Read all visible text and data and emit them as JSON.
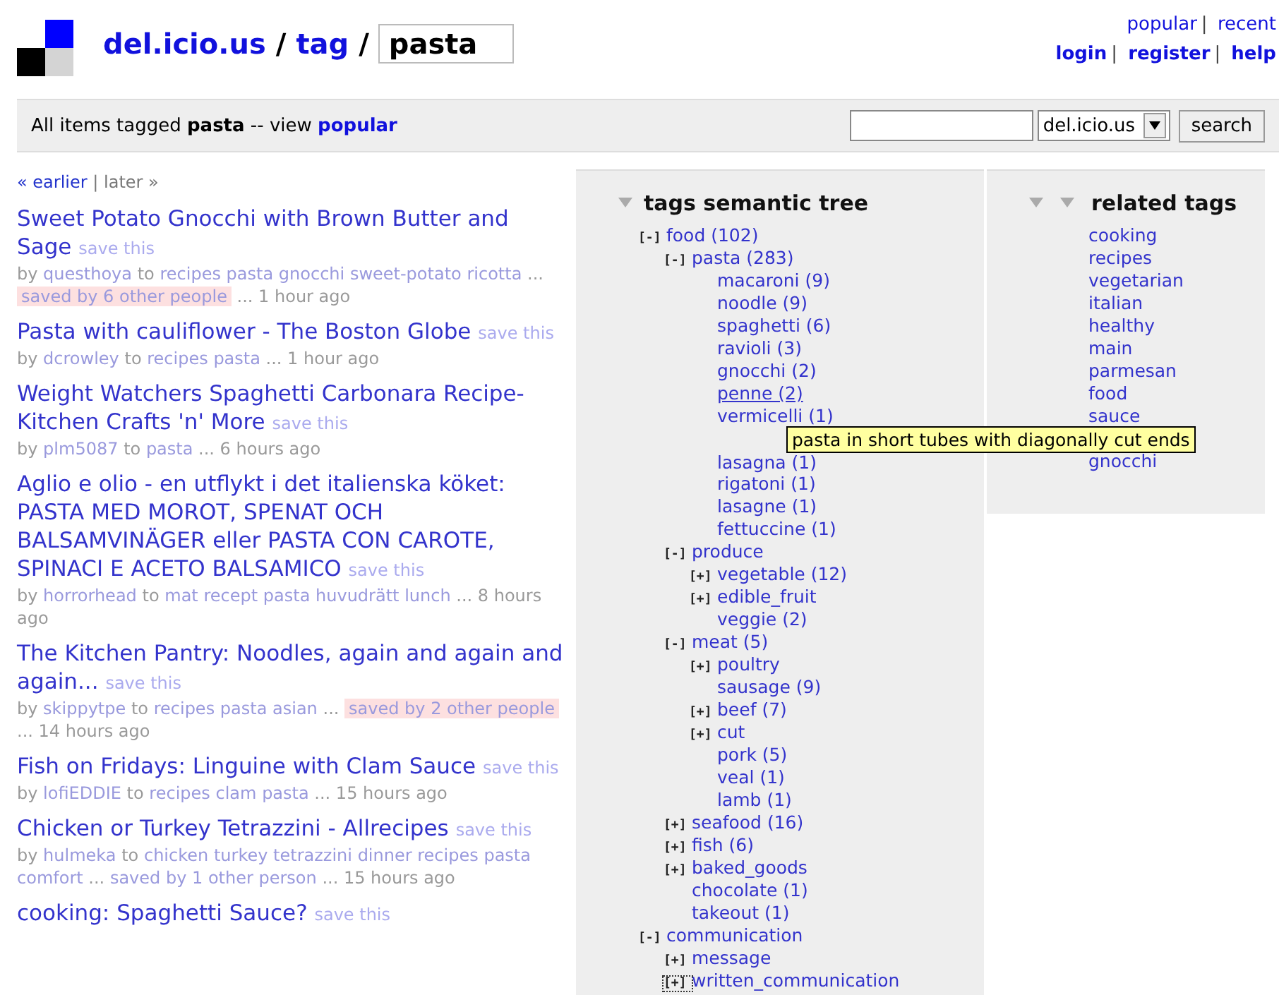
{
  "header": {
    "site": "del.icio.us",
    "sep1": "/",
    "section": "tag",
    "sep2": "/",
    "tag_value": "pasta",
    "top_links": [
      "popular",
      "recent"
    ],
    "top_sep": "|",
    "user_links": [
      "login",
      "register",
      "help"
    ],
    "user_sep": "|"
  },
  "bar": {
    "prefix": "All items tagged",
    "tag": "pasta",
    "middle": "-- view",
    "link": "popular",
    "scope": "del.icio.us",
    "button": "search"
  },
  "pager": {
    "earlier": "« earlier",
    "sep": "|",
    "later": "later »"
  },
  "posts": [
    {
      "title": "Sweet Potato Gnocchi with Brown Butter and Sage",
      "save": "save this",
      "meta": [
        {
          "kind": "plain",
          "text": "by"
        },
        {
          "kind": "link",
          "text": "questhoya"
        },
        {
          "kind": "plain",
          "text": "to"
        },
        {
          "kind": "link",
          "text": "recipes"
        },
        {
          "kind": "link",
          "text": "pasta"
        },
        {
          "kind": "link",
          "text": "gnocchi"
        },
        {
          "kind": "link",
          "text": "sweet-potato"
        },
        {
          "kind": "link",
          "text": "ricotta"
        },
        {
          "kind": "plain",
          "text": "..."
        },
        {
          "kind": "saved",
          "text": "saved by 6 other people"
        },
        {
          "kind": "plain",
          "text": "... 1 hour ago"
        }
      ]
    },
    {
      "title": "Pasta with cauliflower - The Boston Globe",
      "save": "save this",
      "meta": [
        {
          "kind": "plain",
          "text": "by"
        },
        {
          "kind": "link",
          "text": "dcrowley"
        },
        {
          "kind": "plain",
          "text": "to"
        },
        {
          "kind": "link",
          "text": "recipes"
        },
        {
          "kind": "link",
          "text": "pasta"
        },
        {
          "kind": "plain",
          "text": "... 1 hour ago"
        }
      ]
    },
    {
      "title": "Weight Watchers Spaghetti Carbonara Recipe- Kitchen Crafts 'n' More",
      "save": "save this",
      "meta": [
        {
          "kind": "plain",
          "text": "by"
        },
        {
          "kind": "link",
          "text": "plm5087"
        },
        {
          "kind": "plain",
          "text": "to"
        },
        {
          "kind": "link",
          "text": "pasta"
        },
        {
          "kind": "plain",
          "text": "... 6 hours ago"
        }
      ]
    },
    {
      "title": "Aglio e olio - en utflykt i det italienska köket: PASTA MED MOROT, SPENAT OCH BALSAMVINÄGER eller PASTA CON CAROTE, SPINACI E ACETO BALSAMICO",
      "save": "save this",
      "meta": [
        {
          "kind": "plain",
          "text": "by"
        },
        {
          "kind": "link",
          "text": "horrorhead"
        },
        {
          "kind": "plain",
          "text": "to"
        },
        {
          "kind": "link",
          "text": "mat"
        },
        {
          "kind": "link",
          "text": "recept"
        },
        {
          "kind": "link",
          "text": "pasta"
        },
        {
          "kind": "link",
          "text": "huvudrätt"
        },
        {
          "kind": "link",
          "text": "lunch"
        },
        {
          "kind": "plain",
          "text": "... 8 hours ago"
        }
      ]
    },
    {
      "title": "The Kitchen Pantry: Noodles, again and again and again...",
      "save": "save this",
      "meta": [
        {
          "kind": "plain",
          "text": "by"
        },
        {
          "kind": "link",
          "text": "skippytpe"
        },
        {
          "kind": "plain",
          "text": "to"
        },
        {
          "kind": "link",
          "text": "recipes"
        },
        {
          "kind": "link",
          "text": "pasta"
        },
        {
          "kind": "link",
          "text": "asian"
        },
        {
          "kind": "plain",
          "text": "..."
        },
        {
          "kind": "saved",
          "text": "saved by 2 other people"
        },
        {
          "kind": "plain",
          "text": "... 14 hours ago"
        }
      ]
    },
    {
      "title": "Fish on Fridays: Linguine with Clam Sauce",
      "save": "save this",
      "meta": [
        {
          "kind": "plain",
          "text": "by"
        },
        {
          "kind": "link",
          "text": "lofiEDDIE"
        },
        {
          "kind": "plain",
          "text": "to"
        },
        {
          "kind": "link",
          "text": "recipes"
        },
        {
          "kind": "link",
          "text": "clam"
        },
        {
          "kind": "link",
          "text": "pasta"
        },
        {
          "kind": "plain",
          "text": "... 15 hours ago"
        }
      ]
    },
    {
      "title": "Chicken or Turkey Tetrazzini - Allrecipes",
      "save": "save this",
      "meta": [
        {
          "kind": "plain",
          "text": "by"
        },
        {
          "kind": "link",
          "text": "hulmeka"
        },
        {
          "kind": "plain",
          "text": "to"
        },
        {
          "kind": "link",
          "text": "chicken"
        },
        {
          "kind": "link",
          "text": "turkey"
        },
        {
          "kind": "link",
          "text": "tetrazzini"
        },
        {
          "kind": "link",
          "text": "dinner"
        },
        {
          "kind": "link",
          "text": "recipes"
        },
        {
          "kind": "link",
          "text": "pasta"
        },
        {
          "kind": "link",
          "text": "comfort"
        },
        {
          "kind": "plain",
          "text": "..."
        },
        {
          "kind": "link",
          "text": "saved by 1 other person"
        },
        {
          "kind": "plain",
          "text": "... 15 hours ago"
        }
      ]
    },
    {
      "title": "cooking: Spaghetti Sauce?",
      "save": "save this"
    }
  ],
  "tree": {
    "title": "tags semantic tree",
    "nodes": [
      {
        "toggle": "[-]",
        "label": "food (102)",
        "children": [
          {
            "toggle": "[-]",
            "label": "pasta (283)",
            "children": [
              {
                "label": "macaroni (9)"
              },
              {
                "label": "noodle (9)"
              },
              {
                "label": "spaghetti (6)"
              },
              {
                "label": "ravioli (3)"
              },
              {
                "label": "gnocchi (2)"
              },
              {
                "label": "penne (2)",
                "hovered": true
              },
              {
                "label": "vermicelli (1)"
              },
              {
                "label": "lasagna (1)",
                "hidden_above": true
              },
              {
                "label": "rigatoni (1)"
              },
              {
                "label": "lasagne (1)"
              },
              {
                "label": "fettuccine (1)"
              }
            ]
          },
          {
            "toggle": "[-]",
            "label": "produce",
            "children": [
              {
                "toggle": "[+]",
                "label": "vegetable (12)"
              },
              {
                "toggle": "[+]",
                "label": "edible_fruit"
              },
              {
                "label": "veggie (2)"
              }
            ]
          },
          {
            "toggle": "[-]",
            "label": "meat (5)",
            "children": [
              {
                "toggle": "[+]",
                "label": "poultry"
              },
              {
                "label": "sausage (9)"
              },
              {
                "toggle": "[+]",
                "label": "beef (7)"
              },
              {
                "toggle": "[+]",
                "label": "cut"
              },
              {
                "label": "pork (5)"
              },
              {
                "label": "veal (1)"
              },
              {
                "label": "lamb (1)"
              }
            ]
          },
          {
            "toggle": "[+]",
            "label": "seafood (16)"
          },
          {
            "toggle": "[+]",
            "label": "fish (6)"
          },
          {
            "toggle": "[+]",
            "label": "baked_goods"
          },
          {
            "label": "chocolate (1)"
          },
          {
            "label": "takeout (1)"
          }
        ]
      },
      {
        "toggle": "[-]",
        "label": "communication",
        "children": [
          {
            "toggle": "[+]",
            "label": "message"
          },
          {
            "toggle": "[+]",
            "label": "written_communication",
            "focused": true
          }
        ]
      }
    ]
  },
  "related": {
    "title": "related tags",
    "tags": [
      {
        "label": "cooking"
      },
      {
        "label": "recipes"
      },
      {
        "label": "vegetarian"
      },
      {
        "label": "italian"
      },
      {
        "label": "healthy"
      },
      {
        "label": "main"
      },
      {
        "label": "parmesan"
      },
      {
        "label": "food"
      },
      {
        "label": "sauce"
      },
      {
        "label": "gnocchi",
        "hidden_above": true
      }
    ]
  },
  "tooltip": {
    "text": "pasta in short tubes with diagonally cut ends"
  }
}
